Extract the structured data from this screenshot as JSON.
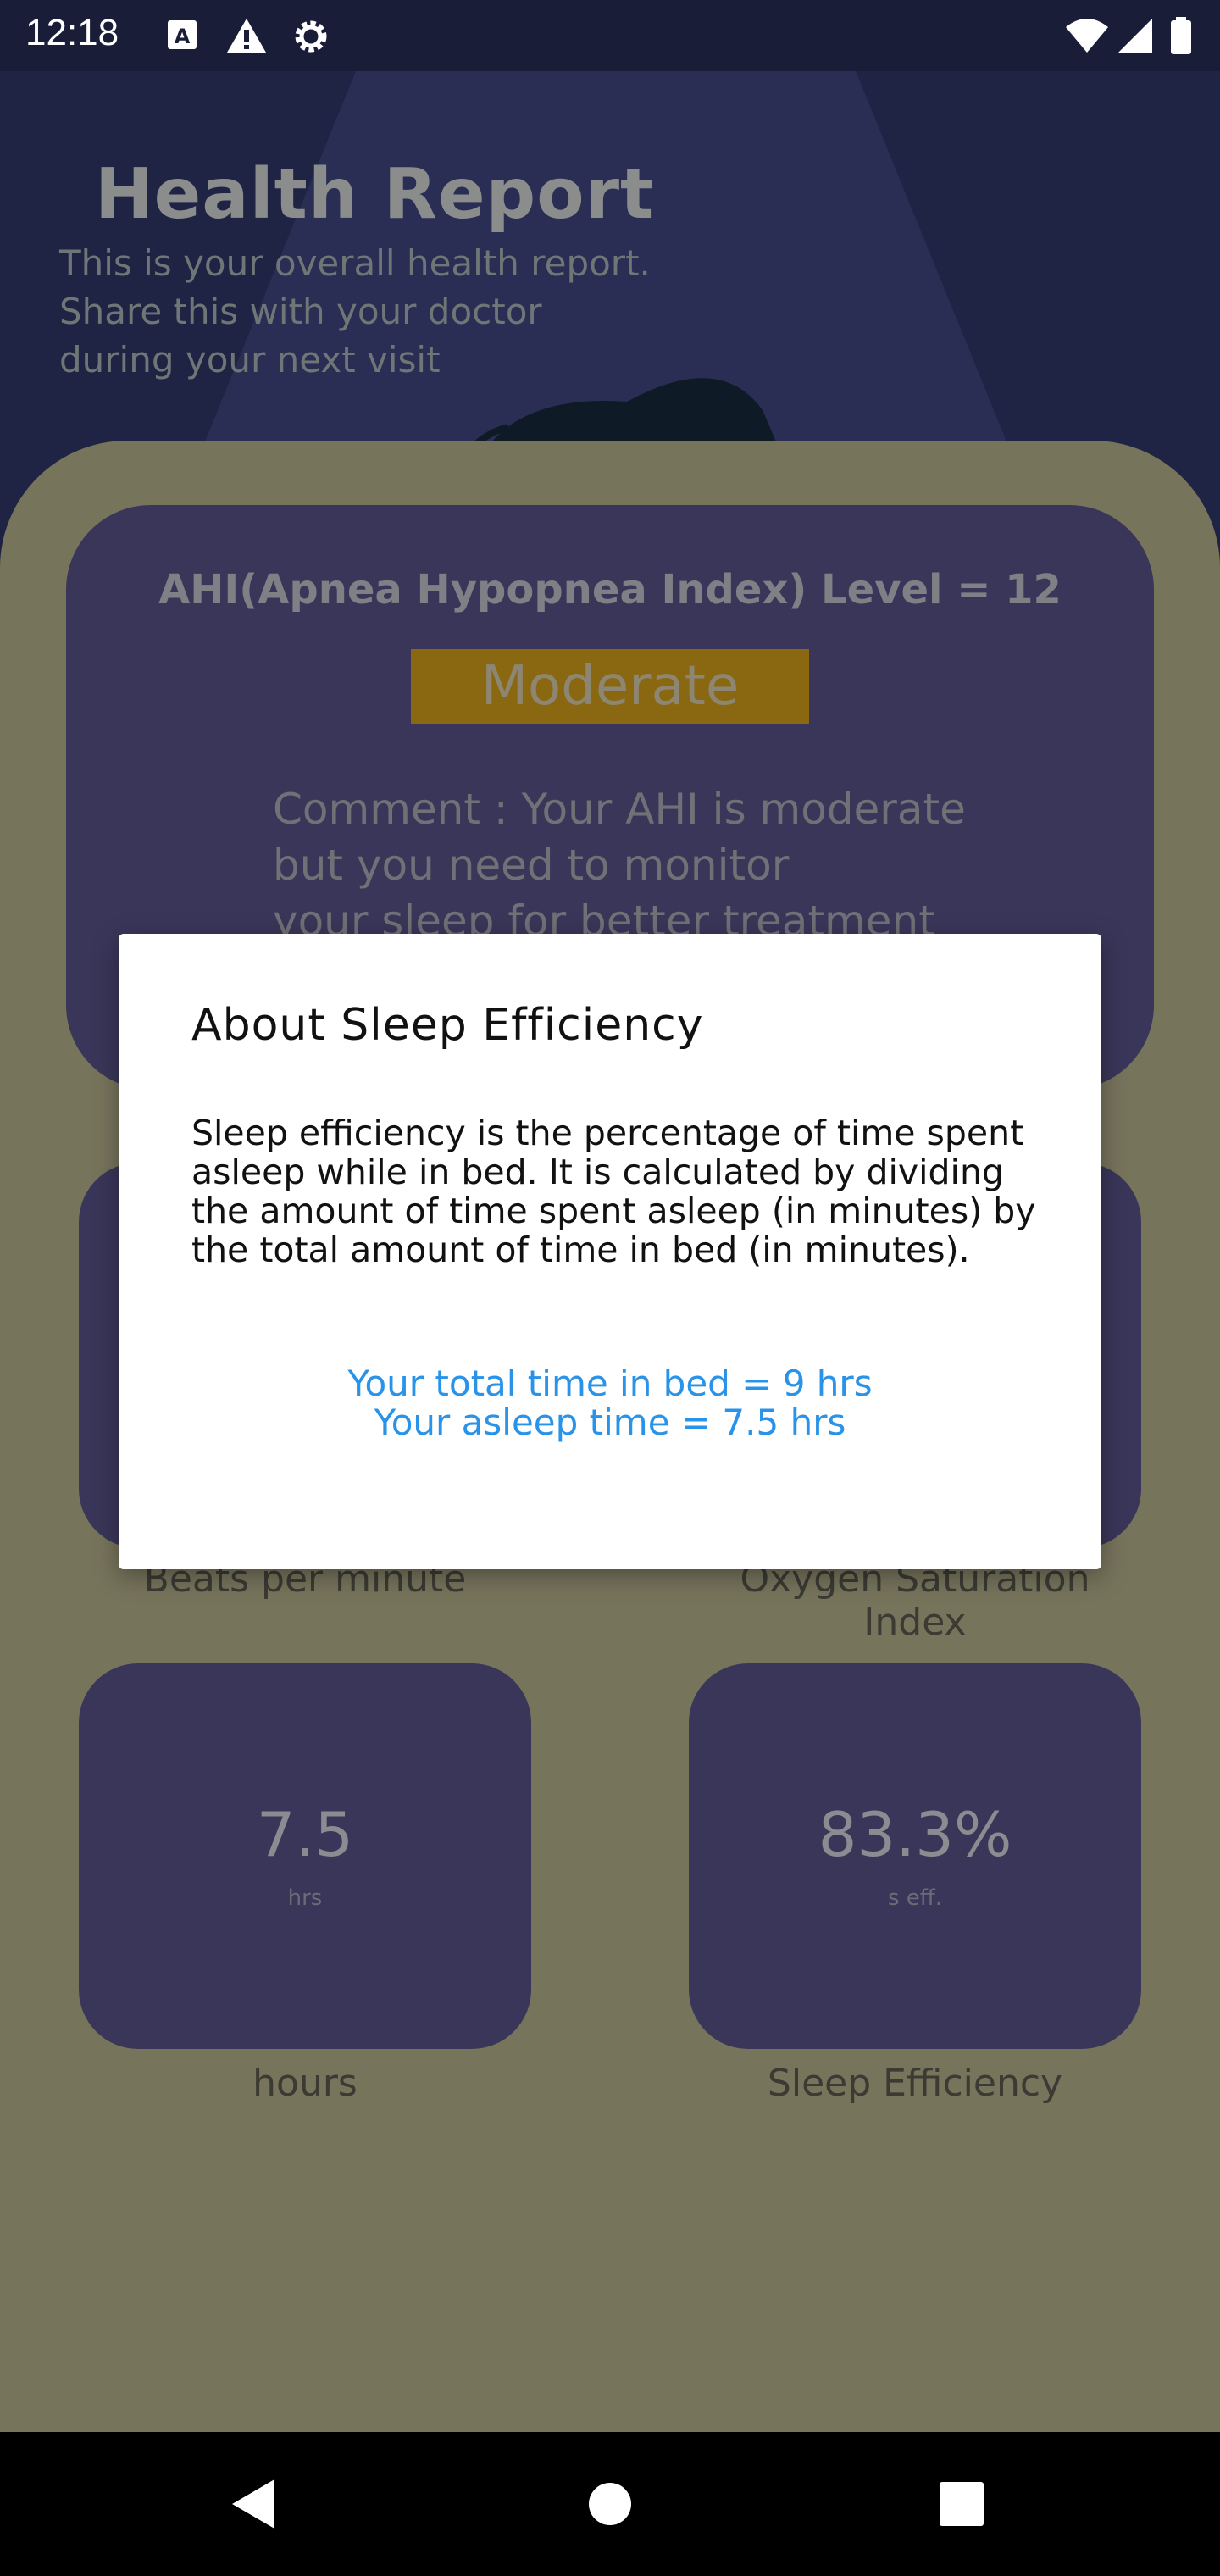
{
  "status_bar": {
    "time": "12:18",
    "icons": [
      "text-a-icon",
      "warning-icon",
      "gear-icon",
      "wifi-icon",
      "signal-icon",
      "battery-icon"
    ]
  },
  "header": {
    "title": "Health Report",
    "subtitle_lines": [
      "This is your overall health report.",
      "Share this with your doctor",
      "during your next visit"
    ]
  },
  "ahi": {
    "title": "AHI(Apnea Hypopnea Index) Level = 12",
    "badge": "Moderate",
    "comment_lines": [
      "Comment : Your AHI is moderate",
      "but you need to monitor",
      "your sleep for better treatment"
    ]
  },
  "stats": {
    "heart": {
      "label": "Beats per minute"
    },
    "oxygen": {
      "label": "Oxygen Saturation Index"
    },
    "sleep_hours": {
      "value": "7.5",
      "unit": "hrs",
      "label": "hours"
    },
    "sleep_efficiency": {
      "value": "83.3%",
      "unit": "s eff.",
      "label": "Sleep Efficiency"
    }
  },
  "dialog": {
    "title": "About Sleep  Efficiency",
    "body": "Sleep efficiency is the percentage of time spent asleep while in bed. It is calculated by dividing the amount of time spent asleep (in minutes) by the total amount of time in bed (in minutes).",
    "info_line_1": "Your total time in bed = 9 hrs",
    "info_line_2": "Your asleep time = 7.5 hrs"
  },
  "colors": {
    "background": "#77745c",
    "card": "#3a3659",
    "badge": "#8a6812",
    "dialog_accent": "#2893e8"
  }
}
